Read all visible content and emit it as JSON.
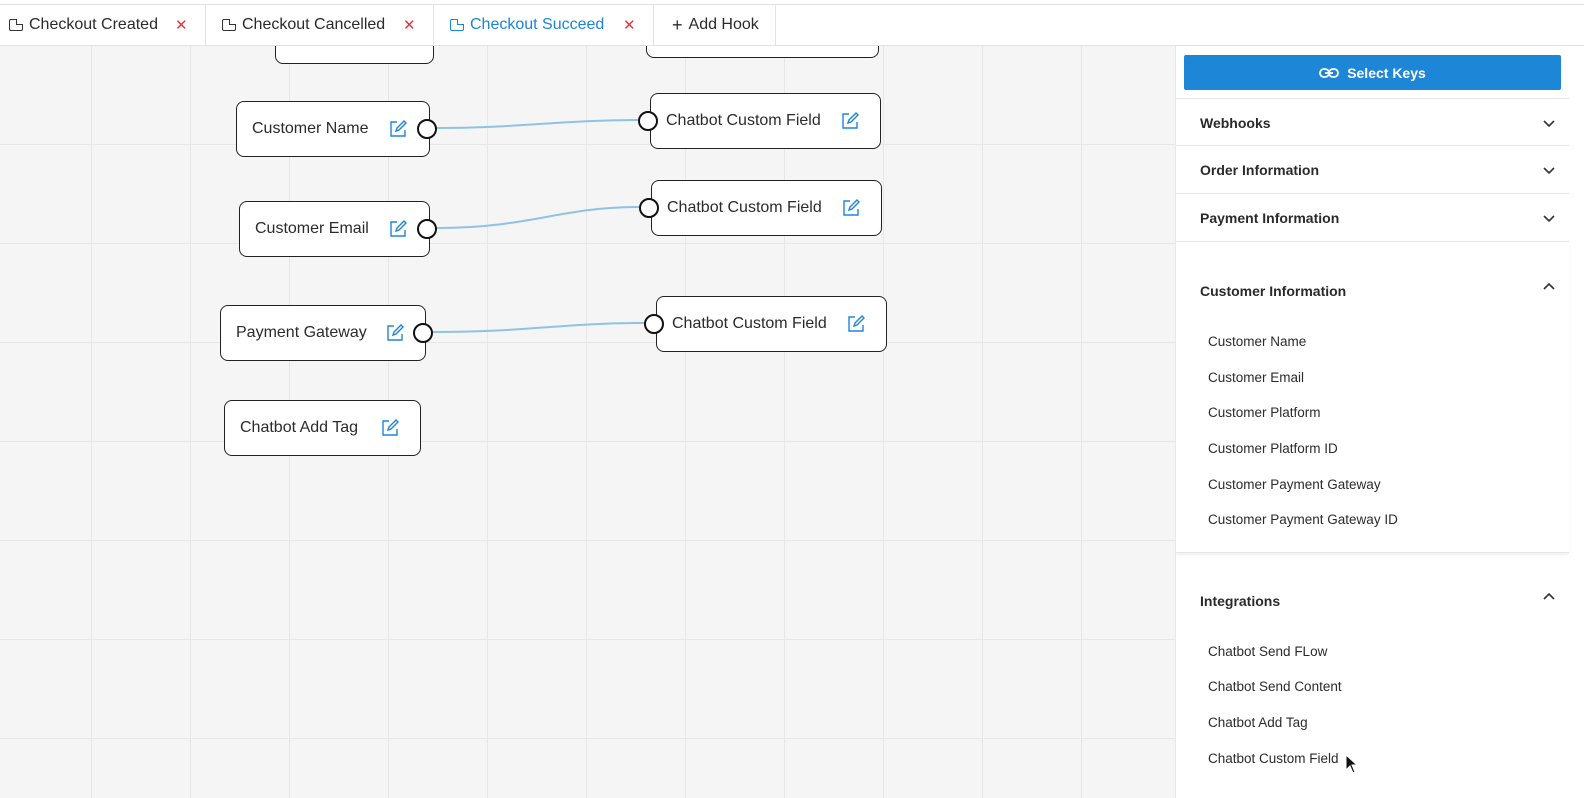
{
  "tabs": [
    {
      "label": "Checkout Created",
      "active": false
    },
    {
      "label": "Checkout Cancelled",
      "active": false
    },
    {
      "label": "Checkout Succeed",
      "active": true
    }
  ],
  "add_hook_label": "Add Hook",
  "canvas": {
    "source_nodes": [
      {
        "label": "Customer Name"
      },
      {
        "label": "Customer Email"
      },
      {
        "label": "Payment Gateway"
      },
      {
        "label": "Chatbot Add Tag"
      }
    ],
    "target_nodes": [
      {
        "label": "Chatbot Custom Field"
      },
      {
        "label": "Chatbot Custom Field"
      },
      {
        "label": "Chatbot Custom Field"
      }
    ],
    "wire_color": "#8ec3e6"
  },
  "sidebar": {
    "select_keys_label": "Select Keys",
    "accent_color": "#1e86d7",
    "sections": [
      {
        "title": "Webhooks",
        "expanded": false
      },
      {
        "title": "Order Information",
        "expanded": false
      },
      {
        "title": "Payment Information",
        "expanded": false
      },
      {
        "title": "Customer Information",
        "expanded": true,
        "items": [
          "Customer Name",
          "Customer Email",
          "Customer Platform",
          "Customer Platform ID",
          "Customer Payment Gateway",
          "Customer Payment Gateway ID"
        ]
      },
      {
        "title": "Integrations",
        "expanded": true,
        "items": [
          "Chatbot Send FLow",
          "Chatbot Send Content",
          "Chatbot Add Tag",
          "Chatbot Custom Field"
        ]
      }
    ]
  }
}
